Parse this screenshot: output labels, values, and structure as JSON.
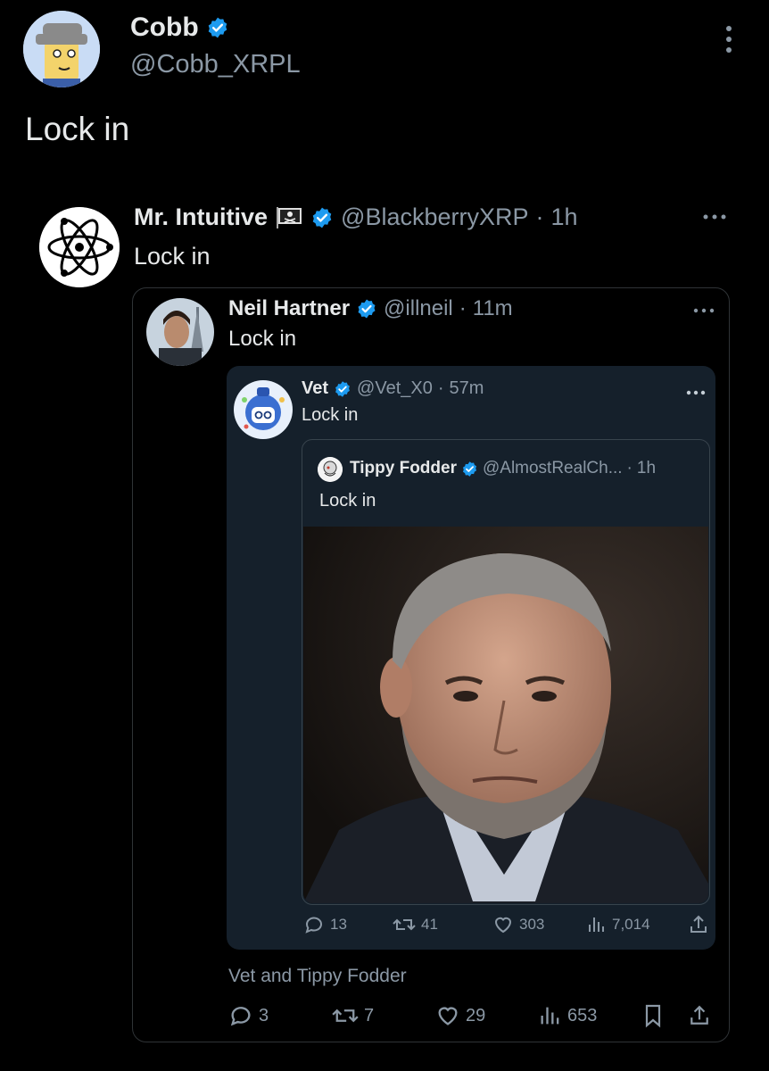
{
  "main_post": {
    "name": "Cobb",
    "handle": "@Cobb_XRPL",
    "text": "Lock in",
    "avatar_icon": "cartoon-avatar-icon"
  },
  "quote1": {
    "name": "Mr. Intuitive",
    "flag_icon": "pirate-flag-icon",
    "handle": "@BlackberryXRP",
    "time": "1h",
    "text": "Lock in",
    "avatar_icon": "atom-icon"
  },
  "quote2": {
    "name": "Neil Hartner",
    "handle": "@illneil",
    "time": "11m",
    "text": "Lock in"
  },
  "quote3": {
    "name": "Vet",
    "handle": "@Vet_X0",
    "time": "57m",
    "text": "Lock in"
  },
  "quote4": {
    "name": "Tippy Fodder",
    "handle": "@AlmostRealCh...",
    "time": "1h",
    "text": "Lock in"
  },
  "quote3_stats": {
    "replies": "13",
    "reposts": "41",
    "likes": "303",
    "views": "7,014"
  },
  "quote2_footer": {
    "mentions": "Vet and Tippy Fodder"
  },
  "quote2_stats": {
    "replies": "3",
    "reposts": "7",
    "likes": "29",
    "views": "653"
  },
  "colors": {
    "background": "#000000",
    "card_dark": "#15202b",
    "verified": "#1d9bf0",
    "muted": "#8b98a5"
  }
}
